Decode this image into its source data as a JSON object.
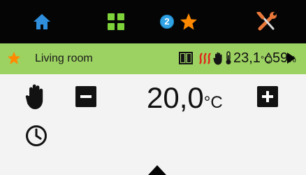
{
  "nav": {
    "home_icon": "home-icon",
    "grid_icon": "grid-icon",
    "favorites_badge": "2",
    "star_icon": "star-icon",
    "tools_icon": "tools-icon"
  },
  "status": {
    "room_name": "Living room",
    "temperature": "23,1",
    "temperature_unit": "°C",
    "humidity": "59",
    "humidity_unit": "%",
    "icons": [
      "window-icon",
      "heating-icon",
      "manual-hand-icon",
      "thermometer-icon",
      "drop-icon",
      "next-arrow-icon"
    ]
  },
  "control": {
    "setpoint": "20,0",
    "setpoint_unit": "°C"
  },
  "colors": {
    "topbar": "#050505",
    "accent_green": "#9cd261",
    "home_blue": "#2f8fdd",
    "grid_green": "#7ed23a",
    "star_orange": "#ff8a00",
    "badge_blue": "#2fa3e6",
    "heating_red": "#e0261b"
  }
}
